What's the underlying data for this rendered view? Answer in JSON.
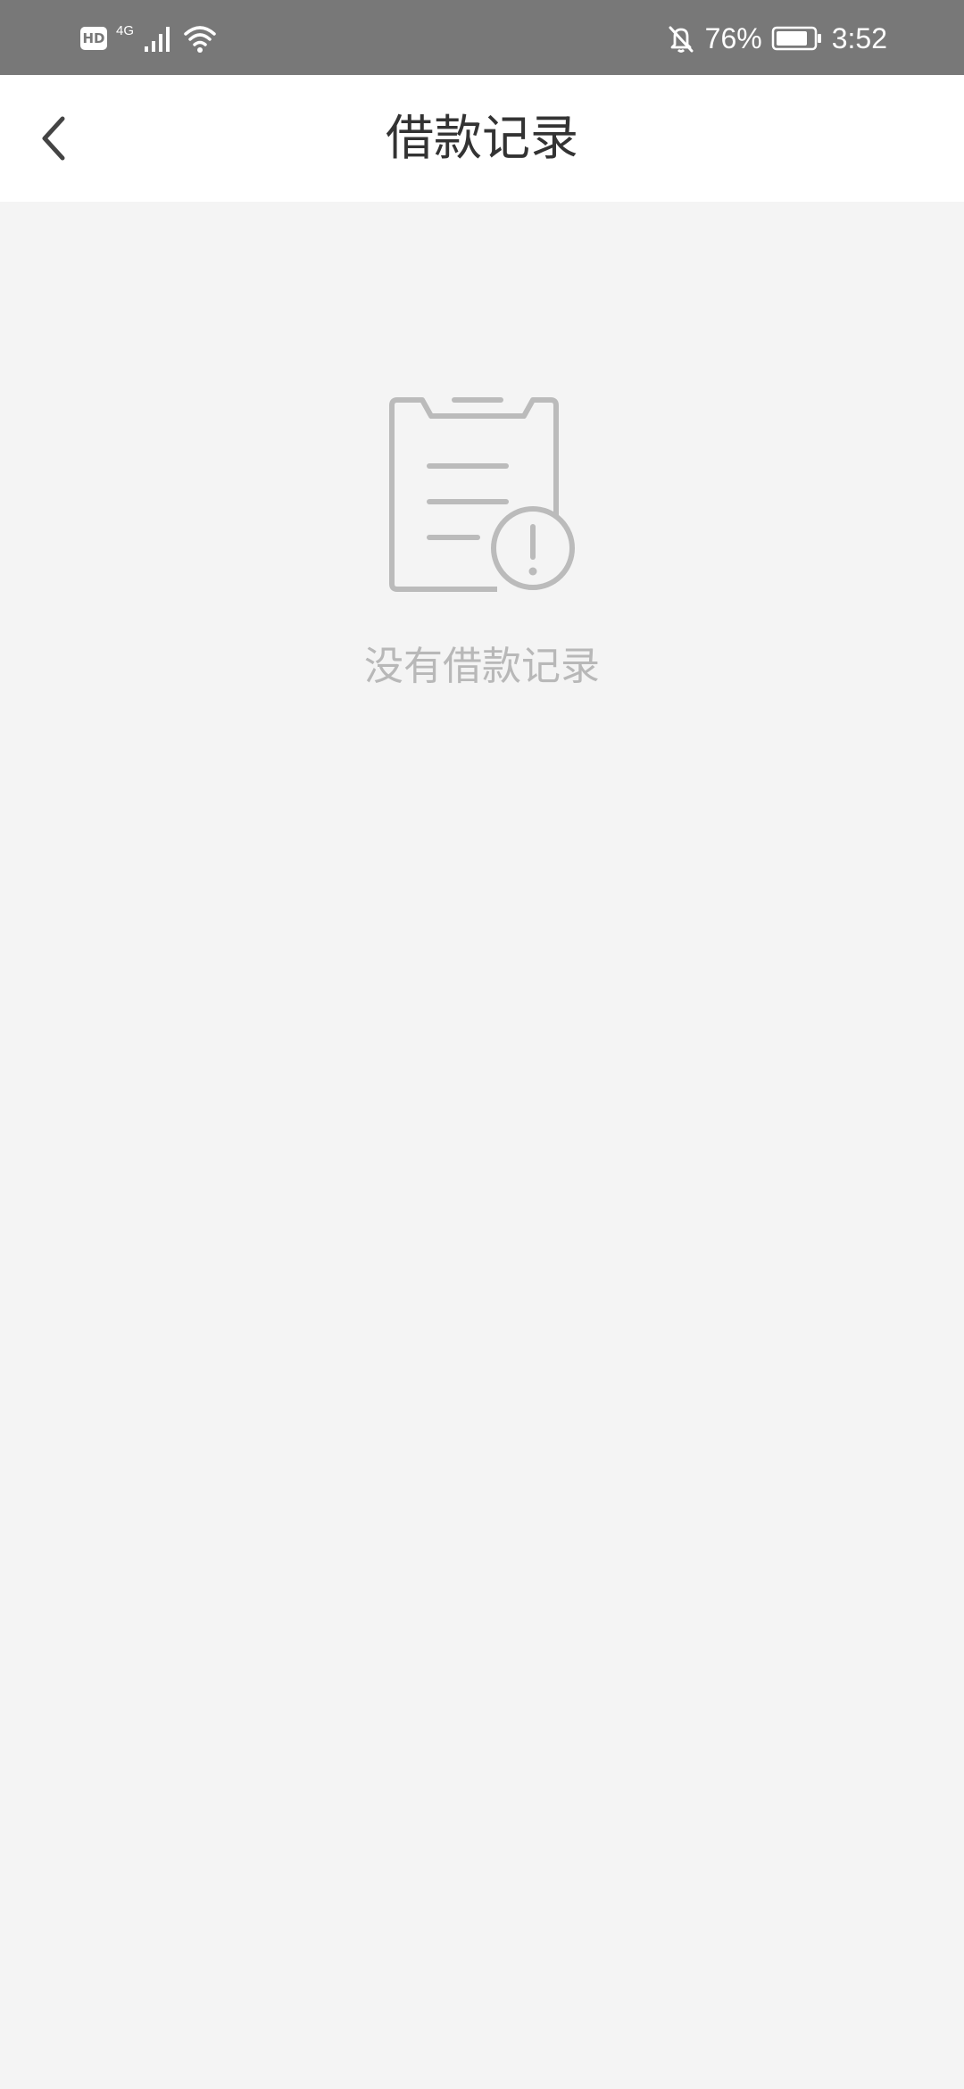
{
  "status_bar": {
    "left_badge": "HD",
    "network_type": "4G",
    "battery_percent": "76%",
    "time": "3:52",
    "icons": [
      "hd-badge",
      "signal-icon",
      "wifi-icon",
      "bell-off-icon",
      "battery-icon"
    ]
  },
  "header": {
    "title": "借款记录",
    "back_icon": "chevron-left-icon"
  },
  "empty_state": {
    "icon": "clipboard-warning-icon",
    "message": "没有借款记录"
  },
  "colors": {
    "status_bar_bg": "#787878",
    "header_bg": "#ffffff",
    "page_bg": "#f4f4f4",
    "title_text": "#333333",
    "empty_text": "#b8b8b8",
    "icon_gray": "#bbbbbb"
  }
}
